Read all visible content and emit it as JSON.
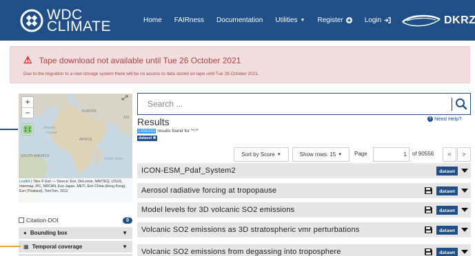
{
  "navbar": {
    "logo_line1": "WDC",
    "logo_line2": "CLIMATE",
    "links": [
      {
        "label": "Home"
      },
      {
        "label": "FAIRness"
      },
      {
        "label": "Documentation"
      },
      {
        "label": "Utilities",
        "dropdown": true
      },
      {
        "label": "Register",
        "icon": "plus-circle-icon"
      },
      {
        "label": "Login",
        "icon": "login-icon"
      }
    ],
    "partner_logo_text": "DKRZ",
    "color": "#1f4f86"
  },
  "alert": {
    "title": "Tape download not available until Tue 26 October 2021",
    "body": "Due to the migration to a new storage system there will be no access to data stored on tape until Tue 26 October 2021.",
    "icon": "warning-icon",
    "color": "#a94442"
  },
  "map": {
    "zoom_in": "+",
    "zoom_out": "−",
    "labels": {
      "europe": "EUROPE",
      "asia": "ASI",
      "atlantic": "Atlantic",
      "ocean": "Ocean",
      "africa": "AFRICA",
      "south_america": "SOUTH AMERICA",
      "indian": "Indian Ocea"
    },
    "attribution_link": "Leaflet",
    "attribution": "| Tiles © Esri — Source: Esri, DeLorme, NAVTEQ, USGS, Intermap, iPC, NRCAN, Esri Japan, METI, Esri China (Hong Kong), Esri (Thailand), TomTom, 2012"
  },
  "facets": {
    "citation_doi": {
      "label": "Citation-DOI",
      "count": "0"
    },
    "bounding_box": {
      "label": "Bounding box",
      "icon": "globe-icon"
    },
    "temporal_coverage": {
      "label": "Temporal coverage",
      "icon": "calendar-icon"
    }
  },
  "search": {
    "placeholder": "Search ...",
    "value": ""
  },
  "results": {
    "title": "Results",
    "count": "1358331",
    "count_suffix": "results found for \"*:*\"",
    "filter_tag": "dataset ✖",
    "need_help": "Need Help?"
  },
  "controls": {
    "sort_label": "Sort by Score",
    "rows_label": "Show rows: 15",
    "page_label": "Page",
    "page_value": "1",
    "page_of": "of 90556",
    "prev": "<",
    "next": ">"
  },
  "rows": [
    {
      "title": "ICON-ESM_Pdaf_System2",
      "badge": "dataset",
      "has_save_icon": false
    },
    {
      "title": "Aerosol radiative forcing at tropopause",
      "badge": "dataset",
      "has_save_icon": true
    },
    {
      "title": "Model levels for 3D volcanic SO2 emissions",
      "badge": "dataset",
      "has_save_icon": true
    },
    {
      "title": "Volcanic SO2 emissions as 3D stratospheric vmr perturbations",
      "badge": "dataset",
      "has_save_icon": true
    },
    {
      "title": "Volcanic SO2 emissions from degassing into troposphere",
      "badge": "dataset",
      "has_save_icon": true
    }
  ]
}
